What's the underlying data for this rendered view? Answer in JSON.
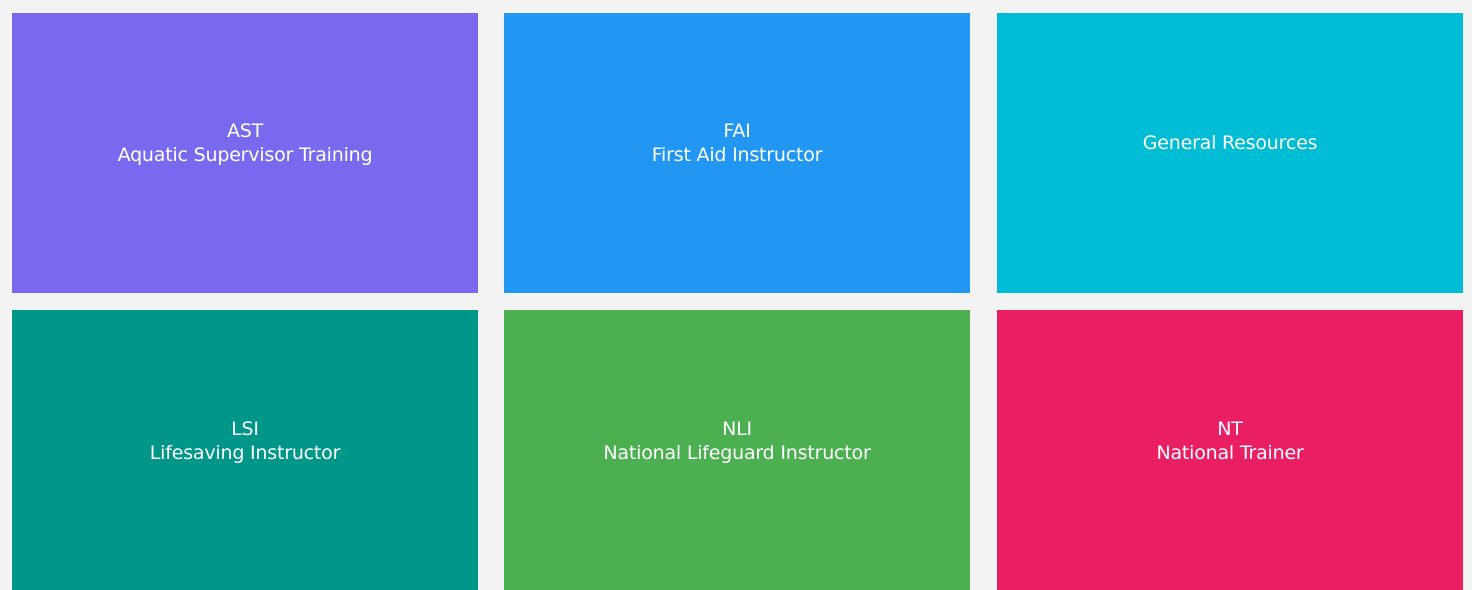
{
  "tiles": [
    {
      "code": "AST",
      "title": "Aquatic Supervisor Training",
      "color": "#7869ef"
    },
    {
      "code": "FAI",
      "title": "First Aid Instructor",
      "color": "#2196f3"
    },
    {
      "code": "",
      "title": "General Resources",
      "color": "#00bcd4"
    },
    {
      "code": "LSI",
      "title": "Lifesaving Instructor",
      "color": "#009688"
    },
    {
      "code": "NLI",
      "title": "National Lifeguard Instructor",
      "color": "#4caf50"
    },
    {
      "code": "NT",
      "title": "National Trainer",
      "color": "#e91e63"
    }
  ]
}
